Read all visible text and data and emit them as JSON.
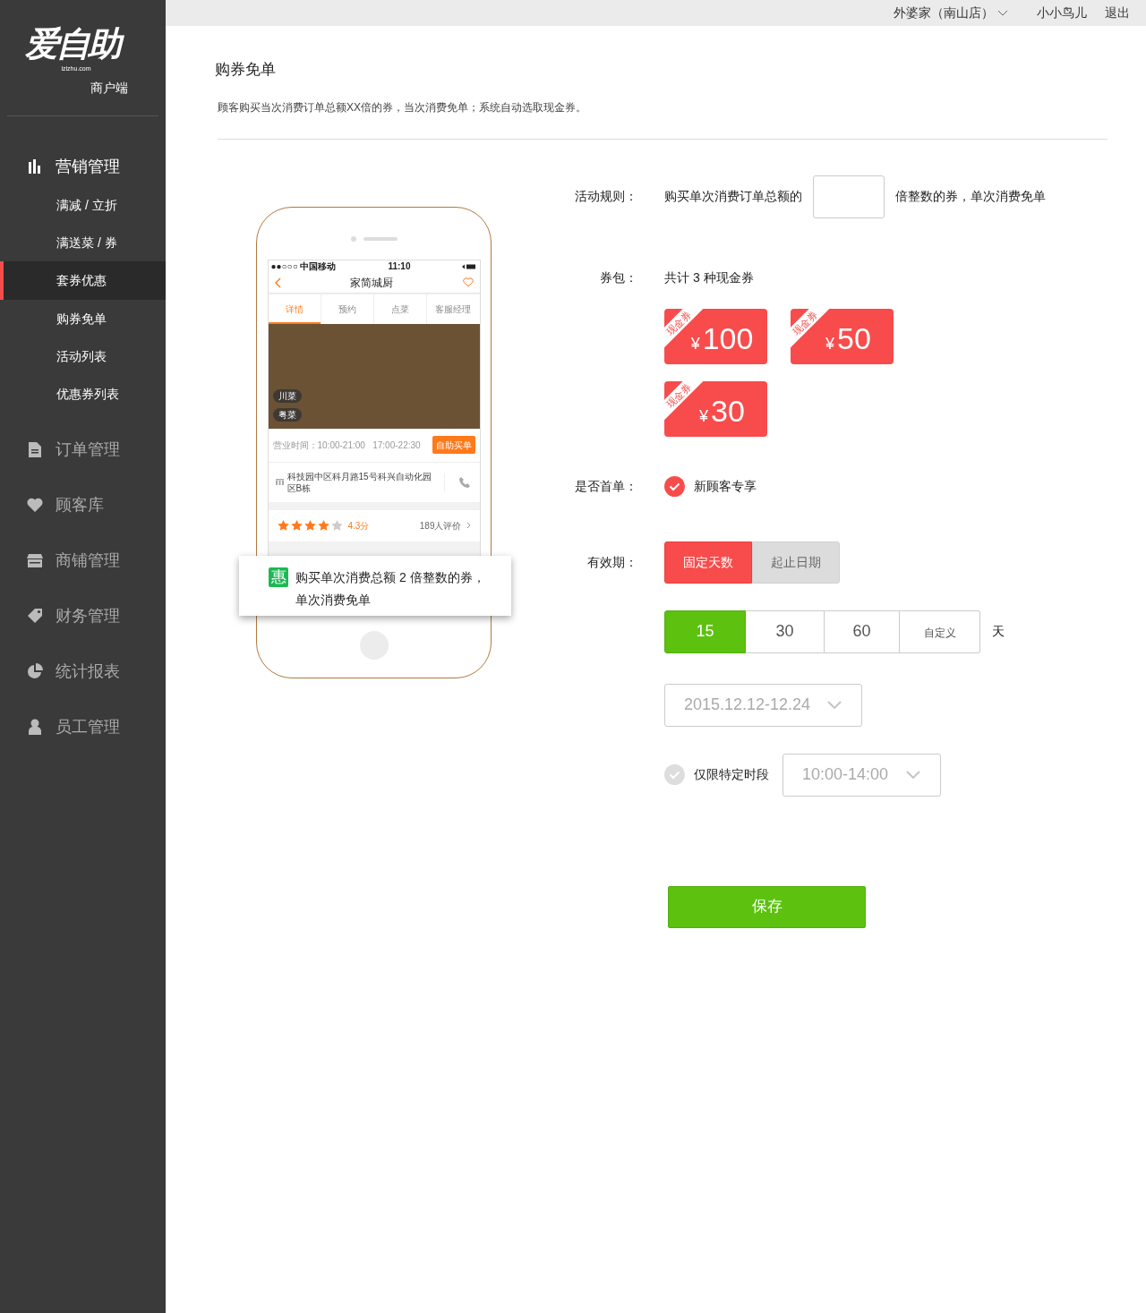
{
  "sidebar": {
    "logo": "爱自助",
    "logo_domain": "izlzhu.com",
    "subtitle": "商户端",
    "items": [
      {
        "kind": "chart",
        "label": "营销管理",
        "children": [
          {
            "label": "满减 / 立折",
            "selected": false
          },
          {
            "label": "满送菜 / 券",
            "selected": false
          },
          {
            "label": "套券优惠",
            "selected": true
          },
          {
            "label": "购券免单",
            "selected": false
          },
          {
            "label": "活动列表",
            "selected": false
          },
          {
            "label": "优惠券列表",
            "selected": false
          }
        ]
      },
      {
        "kind": "document",
        "label": "订单管理"
      },
      {
        "kind": "heart",
        "label": "顾客库"
      },
      {
        "kind": "store",
        "label": "商铺管理"
      },
      {
        "kind": "tag",
        "label": "财务管理"
      },
      {
        "kind": "pie",
        "label": "统计报表"
      },
      {
        "kind": "person",
        "label": "员工管理"
      }
    ]
  },
  "top_bar": {
    "store": "外婆家（南山店）",
    "user": "小小鸟儿",
    "logout": "退出"
  },
  "page": {
    "title": "购券免单",
    "description": "顾客购买当次消费订单总额XX倍的券，当次消费免单；系统自动选取现金券。"
  },
  "preview": {
    "carrier": "●●○○○ 中国移动",
    "time": "11:10",
    "title": "家简城厨",
    "tabs": [
      {
        "label": "详情",
        "selected": true
      },
      {
        "label": "预约",
        "selected": false
      },
      {
        "label": "点菜",
        "selected": false
      },
      {
        "label": "客服经理",
        "selected": false
      }
    ],
    "photo_tags": [
      "川菜",
      "粤菜"
    ],
    "hours": "营业时间：10:00-21:00   17:00-22:30",
    "buy_button": "自助买单",
    "address": "科技园中区科月路15号科兴自动化园区B栋",
    "stars": 4,
    "score": "4.3分",
    "reviews": "189人评价",
    "tooltip": {
      "badge": "惠",
      "text": "购买单次消费总额 2 倍整数的券，单次消费免单"
    }
  },
  "form": {
    "rule": {
      "label": "活动规则：",
      "prefix": "购买单次消费订单总额的",
      "suffix": "倍整数的券，单次消费免单"
    },
    "coupons": {
      "label": "券包：",
      "summary": "共计 3 种现金券",
      "items": [
        {
          "ribbon": "现金券",
          "currency": "¥",
          "amount": "100"
        },
        {
          "ribbon": "现金券",
          "currency": "¥",
          "amount": "50"
        },
        {
          "ribbon": "现金券",
          "currency": "¥",
          "amount": "30"
        }
      ]
    },
    "first_order": {
      "label": "是否首单：",
      "option": "新顾客专享",
      "checked": true
    },
    "validity": {
      "label": "有效期：",
      "modes": [
        {
          "label": "固定天数",
          "selected": true
        },
        {
          "label": "起止日期",
          "selected": false
        }
      ],
      "days": [
        {
          "label": "15",
          "selected": true
        },
        {
          "label": "30",
          "selected": false
        },
        {
          "label": "60",
          "selected": false
        },
        {
          "label": "自定义",
          "selected": false
        }
      ],
      "unit": "天",
      "date_range": "2015.12.12-12.24",
      "time_limit": {
        "label": "仅限特定时段",
        "checked": false,
        "value": "10:00-14:00"
      }
    },
    "save": "保存"
  }
}
